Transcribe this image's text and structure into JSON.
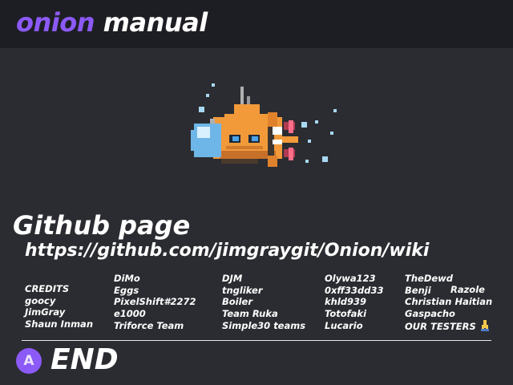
{
  "header": {
    "brand_accent": "onion",
    "brand_rest": "manual"
  },
  "mascot": {
    "icon": "onion-submarine-icon"
  },
  "github": {
    "title": "Github page",
    "url": "https://github.com/jimgraygit/Onion/wiki"
  },
  "credits": {
    "columns": [
      [
        "CREDITS",
        "goocy",
        "JimGray",
        "Shaun Inman"
      ],
      [
        "DiMo",
        "Eggs",
        "PixelShift#2272",
        "e1000",
        "Triforce Team"
      ],
      [
        "DJM",
        "tngliker",
        "Boiler",
        "Team Ruka",
        "Simple30 teams"
      ],
      [
        "Olywa123",
        "0xff33dd33",
        "khld939",
        "Totofaki",
        "Lucario"
      ],
      [
        "TheDewd",
        "Benji",
        "Christian Haitian",
        "Gaspacho",
        "OUR TESTERS"
      ]
    ],
    "extra": "Razole",
    "testers_icon": "praying-hands-icon"
  },
  "footer": {
    "button_label": "A",
    "action_label": "END"
  },
  "colors": {
    "accent": "#8c5af7",
    "background": "#2b2c31",
    "header_background": "#1d1e23"
  }
}
